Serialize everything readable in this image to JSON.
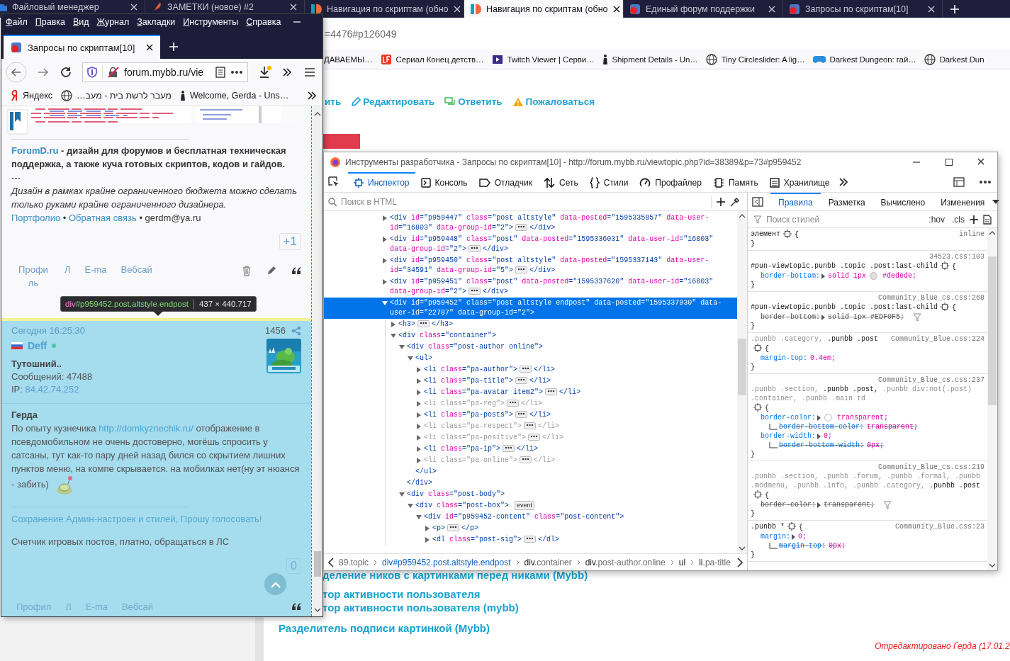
{
  "background_window": {
    "tabs": [
      {
        "label": "Файловый менеджер",
        "kind": "files",
        "selected": false
      },
      {
        "label": "ЗАМЕТКИ (новое) #2",
        "kind": "notes",
        "selected": false
      },
      {
        "label": "Навигация по скриптам (обно",
        "kind": "site",
        "selected": false
      },
      {
        "label": "Навигация по скриптам (обно",
        "kind": "site",
        "selected": true
      },
      {
        "label": "Единый форум поддержки",
        "kind": "forum",
        "selected": false
      },
      {
        "label": "Запросы по скриптам[10]",
        "kind": "forum",
        "selected": false
      }
    ],
    "address": "=4476#p126049",
    "bookmarks": [
      {
        "label": "ДАВАЕМЫ…",
        "kind": "plain"
      },
      {
        "label": "Сериал Конец детств…",
        "kind": "red"
      },
      {
        "label": "Twitch Viewer | Серви…",
        "kind": "video"
      },
      {
        "label": "Shipment Details - Un…",
        "kind": "figure"
      },
      {
        "label": "Tiny Circleslider: A lig…",
        "kind": "globe"
      },
      {
        "label": "Darkest Dungeon: гай…",
        "kind": "gamepad"
      },
      {
        "label": "Darkest Dun",
        "kind": "globe"
      }
    ],
    "post_actions": [
      {
        "label": "ить",
        "kind": "plain"
      },
      {
        "label": "Редактировать",
        "kind": "edit"
      },
      {
        "label": "Ответить",
        "kind": "reply"
      },
      {
        "label": "Пожаловаться",
        "kind": "report"
      }
    ],
    "topic_links": [
      "деление ников с картинками перед никами (Mybb)",
      "тор активности пользователя",
      "тор активности пользователя (mybb)",
      "Разделитель подписи картинкой (Mybb)"
    ],
    "edited_note": "Отредактировано Герда (17.01.2"
  },
  "left_window": {
    "menu": [
      "Файл",
      "Правка",
      "Вид",
      "Журнал",
      "Закладки",
      "Инструменты",
      "Справка"
    ],
    "tabs": [
      {
        "label": "Запросы по скриптам[10]",
        "selected": true
      }
    ],
    "address": "forum.mybb.ru/vie",
    "bookmarks": [
      {
        "label": "Яндекс",
        "kind": "logo"
      },
      {
        "label": "מעבר לרשת בית - מעב…",
        "kind": "globe",
        "rtl": true
      },
      {
        "label": "Welcome, Gerda - Uns…",
        "kind": "figure"
      }
    ],
    "first_post": {
      "signature": {
        "site": "ForumD.ru",
        "text": " - дизайн для форумов и бесплатная техническая поддержка, а также куча готовых скриптов, кодов и гайдов."
      },
      "divider": "---",
      "motto": "Дизайн в рамках крайне ограниченного бюджета можно сделать только руками крайне ограниченного дизайнера.",
      "footer": [
        {
          "kind": "link",
          "text": "Портфолио"
        },
        {
          "kind": "text",
          "text": " • "
        },
        {
          "kind": "link",
          "text": "Обратная связь"
        },
        {
          "kind": "text",
          "text": " • gerdm@ya.ru"
        }
      ],
      "vote": "+1",
      "links": [
        "Профиль",
        "Л",
        "E-ma",
        "Вебсай"
      ],
      "tools": [
        {
          "kind": "delete"
        },
        {
          "kind": "edit"
        },
        {
          "kind": "quote"
        }
      ]
    },
    "tooltip": {
      "tag": "div",
      "selector": "#p959452.post.altstyle.endpost",
      "size": "437 × 440.717"
    },
    "second_post": {
      "highlighted": true,
      "time": "Сегодня 16:25:30",
      "number": "1456",
      "author": "Deff",
      "online": true,
      "rank": "Тутошний..",
      "posts": "Сообщений: 47488",
      "ip_label": "IP: ",
      "ip": "84.42.74.252",
      "addressee": "Герда",
      "message": {
        "before": "По опыту кузнечика ",
        "link": "http://domkyznechik.ru/",
        "after": " отображение в псевдомобильном не очень достоверно, могёшь спросить у сатсаны, тут как-то пару дней назад бился со скрытием лишних пунктов меню, на компе скрывается. на мобилках нет(ну эт нюанся - забить)"
      },
      "sig_link": "Сохранение Админ-настроек и стилей, Прошу голосовать!",
      "sig_text": "Счетчик игровых постов, платно, обращаться в ЛС",
      "vote": "0",
      "links": [
        "Профил",
        "Л",
        "E-ma",
        "Вебсай"
      ],
      "tools": [
        {
          "kind": "quote"
        }
      ]
    }
  },
  "devtools": {
    "title": "Инструменты разработчика - Запросы по скриптам[10] - http://forum.mybb.ru/viewtopic.php?id=38389&p=73#p959452",
    "tools": [
      {
        "label": "Инспектор",
        "kind": "inspector",
        "selected": true
      },
      {
        "label": "Консоль",
        "kind": "console",
        "selected": false
      },
      {
        "label": "Отладчик",
        "kind": "debugger",
        "selected": false
      },
      {
        "label": "Сеть",
        "kind": "network",
        "selected": false
      },
      {
        "label": "Стили",
        "kind": "styles",
        "selected": false
      },
      {
        "label": "Профайлер",
        "kind": "performance",
        "selected": false
      },
      {
        "label": "Память",
        "kind": "memory",
        "selected": false
      },
      {
        "label": "Хранилище",
        "kind": "storage",
        "selected": false
      }
    ],
    "search_placeholder": "Поиск в HTML",
    "nodes": [
      {
        "open": "<div id=\"p959447\" class=\"post altstyle\" data-posted=\"1595335857\" data-user-id=\"16803\" data-group-id=\"2\">",
        "close": "</div>",
        "expanded": false,
        "selected": false,
        "dim": false
      },
      {
        "open": "<div id=\"p959448\" class=\"post\" data-posted=\"1595336031\" data-user-id=\"16803\" data-group-id=\"2\">",
        "close": "</div>",
        "expanded": false,
        "selected": false,
        "dim": false
      },
      {
        "open": "<div id=\"p959450\" class=\"post altstyle\" data-posted=\"1595337143\" data-user-id=\"34591\" data-group-id=\"5\">",
        "close": "</div>",
        "expanded": false,
        "selected": false,
        "dim": false
      },
      {
        "open": "<div id=\"p959451\" class=\"post\" data-posted=\"1595337620\" data-user-id=\"16803\" data-group-id=\"2\">",
        "close": "</div>",
        "expanded": false,
        "selected": false,
        "dim": false
      },
      {
        "open": "<div id=\"p959452\" class=\"post altstyle endpost\" data-posted=\"1595337930\" data-user-id=\"22787\" data-group-id=\"2\">",
        "expanded": true,
        "selected": true,
        "dim": false,
        "children": [
          {
            "open": "<h3>",
            "close": "</h3>",
            "expanded": false,
            "selected": false,
            "dim": false
          },
          {
            "open": "<div class=\"container\">",
            "expanded": true,
            "selected": false,
            "dim": false,
            "children": [
              {
                "open": "<div class=\"post-author online\">",
                "close": "</div>",
                "expanded": true,
                "selected": false,
                "dim": false,
                "children": [
                  {
                    "open": "<ul>",
                    "close": "</ul>",
                    "expanded": true,
                    "selected": false,
                    "dim": false,
                    "children": [
                      {
                        "open": "<li class=\"pa-author\">",
                        "close": "</li>",
                        "expanded": false,
                        "selected": false,
                        "dim": false
                      },
                      {
                        "open": "<li class=\"pa-title\">",
                        "close": "</li>",
                        "expanded": false,
                        "selected": false,
                        "dim": false
                      },
                      {
                        "open": "<li class=\"pa-avatar item2\">",
                        "close": "</li>",
                        "expanded": false,
                        "selected": false,
                        "dim": false
                      },
                      {
                        "open": "<li class=\"pa-reg\">",
                        "close": "</li>",
                        "expanded": false,
                        "selected": false,
                        "dim": true
                      },
                      {
                        "open": "<li class=\"pa-posts\">",
                        "close": "</li>",
                        "expanded": false,
                        "selected": false,
                        "dim": false
                      },
                      {
                        "open": "<li class=\"pa-respect\">",
                        "close": "</li>",
                        "expanded": false,
                        "selected": false,
                        "dim": true
                      },
                      {
                        "open": "<li class=\"pa-positive\">",
                        "close": "</li>",
                        "expanded": false,
                        "selected": false,
                        "dim": true
                      },
                      {
                        "open": "<li class=\"pa-ip\">",
                        "close": "</li>",
                        "expanded": false,
                        "selected": false,
                        "dim": false
                      },
                      {
                        "open": "<li class=\"pa-online\">",
                        "close": "</li>",
                        "expanded": false,
                        "selected": false,
                        "dim": true
                      }
                    ]
                  }
                ]
              },
              {
                "open": "<div class=\"post-body\">",
                "expanded": true,
                "selected": false,
                "dim": false,
                "children": [
                  {
                    "open": "<div class=\"post-box\">",
                    "event": "event",
                    "expanded": true,
                    "selected": false,
                    "dim": false,
                    "children": [
                      {
                        "open": "<div id=\"p959452-content\" class=\"post-content\">",
                        "expanded": true,
                        "selected": false,
                        "dim": false,
                        "children": [
                          {
                            "open": "<p>",
                            "close": "</p>",
                            "expanded": false,
                            "selected": false,
                            "dim": false
                          },
                          {
                            "open": "<dl class=\"post-sig\">",
                            "close": "</dl>",
                            "expanded": false,
                            "selected": false,
                            "dim": false
                          }
                        ]
                      }
                    ]
                  }
                ]
              }
            ]
          }
        ]
      }
    ],
    "breadcrumbs": [
      {
        "rest": "89.topic",
        "selected": false
      },
      {
        "tag": "div",
        "rest": "#p959452.post.altstyle.endpost",
        "selected": true
      },
      {
        "tag": "div",
        "rest": ".container",
        "selected": false
      },
      {
        "tag": "div",
        "rest": ".post-author.online",
        "selected": false
      },
      {
        "tag": "ul",
        "selected": false
      },
      {
        "tag": "li",
        "rest": ".pa-title",
        "selected": false
      }
    ],
    "sidebar_tabs": [
      {
        "label": "Правила",
        "selected": true
      },
      {
        "label": "Разметка",
        "selected": false
      },
      {
        "label": "Вычислено",
        "selected": false
      },
      {
        "label": "Изменения",
        "selected": false
      }
    ],
    "filter_placeholder": "Поиск стилей",
    "toggles": [
      ":hov",
      ".cls"
    ],
    "rules": [
      {
        "selector": [
          {
            "text": "элемент",
            "matched": true
          }
        ],
        "source": "inline",
        "open": "{",
        "close": "}"
      },
      {
        "selector": [
          {
            "text": "#pun-viewtopic.punbb .topic .post:last-child",
            "matched": true
          }
        ],
        "source": "34523.css:103",
        "open": "{",
        "close": "}",
        "declarations": [
          {
            "prop": "border-bottom:",
            "expandable": true,
            "overridden": false,
            "parts": [
              {
                "kind": "text",
                "text": "solid 1px"
              },
              {
                "kind": "swatch",
                "color": "#dedede"
              },
              {
                "kind": "text",
                "text": "#dedede;"
              }
            ]
          }
        ]
      },
      {
        "selector": [
          {
            "text": "#pun-viewtopic.punbb .topic .post:last-child",
            "matched": true
          }
        ],
        "source": "Community_Blue_cs.css:268",
        "open": "{",
        "close": "}",
        "declarations": [
          {
            "prop": "border-bottom:",
            "expandable": true,
            "overridden": true,
            "filter_icon": true,
            "parts": [
              {
                "kind": "text",
                "text": "solid 1px #EDF0F5;"
              }
            ]
          }
        ]
      },
      {
        "selector": [
          {
            "text": ".punbb .category,",
            "matched": false
          },
          {
            "text": ".punbb .post",
            "matched": true
          }
        ],
        "source": "Community_Blue.css:224",
        "open": "{",
        "close": "}",
        "declarations": [
          {
            "prop": "margin-top:",
            "expandable": false,
            "overridden": false,
            "parts": [
              {
                "kind": "text",
                "text": "0.4em;"
              }
            ]
          }
        ]
      },
      {
        "selector": [
          {
            "text": ".punbb .section,",
            "matched": false
          },
          {
            "text": ".punbb .post,",
            "matched": true
          },
          {
            "text": ".punbb div:not(.post) .container,",
            "matched": false
          },
          {
            "text": ".punbb .main td",
            "matched": false
          }
        ],
        "source": "Community_Blue_cs.css:237",
        "open": "{",
        "close": "}",
        "declarations": [
          {
            "prop": "border-color:",
            "expandable": true,
            "overridden": false,
            "parts": [
              {
                "kind": "swatch_empty"
              },
              {
                "kind": "text",
                "text": "transparent;"
              }
            ],
            "longhands": [
              {
                "prop": "border-bottom-color:",
                "value": "transparent;",
                "overridden": true
              }
            ]
          },
          {
            "prop": "border-width:",
            "expandable": true,
            "overridden": false,
            "parts": [
              {
                "kind": "text",
                "text": "0;"
              }
            ],
            "longhands": [
              {
                "prop": "border-bottom-width:",
                "value": "0px;",
                "overridden": true
              }
            ]
          }
        ]
      },
      {
        "selector": [
          {
            "text": ".punbb .section,",
            "matched": false
          },
          {
            "text": ".punbb .forum,",
            "matched": false
          },
          {
            "text": ".punbb .formal,",
            "matched": false
          },
          {
            "text": ".punbb .modmenu,",
            "matched": false
          },
          {
            "text": ".punbb .info,",
            "matched": false
          },
          {
            "text": ".punbb .category,",
            "matched": false
          },
          {
            "text": ".punbb .post",
            "matched": true
          }
        ],
        "source": "Community_Blue_cs.css:219",
        "open": "{",
        "close": "}",
        "declarations": [
          {
            "prop": "border-color:",
            "expandable": true,
            "overridden": true,
            "filter_icon": true,
            "parts": [
              {
                "kind": "text",
                "text": "transparent;"
              }
            ]
          }
        ]
      },
      {
        "selector": [
          {
            "text": ".punbb *",
            "matched": true
          }
        ],
        "source": "Community_Blue.css:23",
        "open": "{",
        "close": "}",
        "declarations": [
          {
            "prop": "margin:",
            "expandable": true,
            "overridden": false,
            "parts": [
              {
                "kind": "text",
                "text": "0;"
              }
            ],
            "longhands": [
              {
                "prop": "margin-top:",
                "value": "0px;",
                "overridden": true
              }
            ]
          }
        ]
      }
    ]
  }
}
